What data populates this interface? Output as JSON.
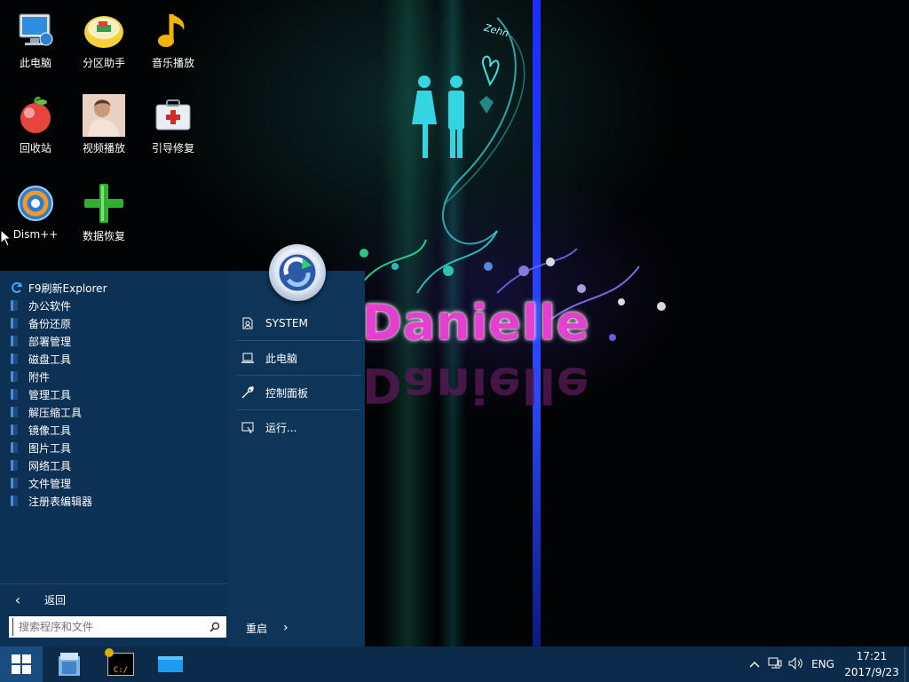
{
  "wallpaper": {
    "brand_text": "Danielle",
    "tag_text": "Zehn"
  },
  "desktop_icons": [
    {
      "label": "此电脑",
      "icon": "computer-icon"
    },
    {
      "label": "分区助手",
      "icon": "partition-assistant-icon"
    },
    {
      "label": "音乐播放",
      "icon": "music-note-icon"
    },
    {
      "label": "回收站",
      "icon": "recycle-bin-icon"
    },
    {
      "label": "视频播放",
      "icon": "video-player-icon"
    },
    {
      "label": "引导修复",
      "icon": "first-aid-kit-icon"
    },
    {
      "label": "Dism++",
      "icon": "dism-icon"
    },
    {
      "label": "数据恢复",
      "icon": "green-plus-icon"
    }
  ],
  "start_menu": {
    "refresh_label": "F9刷新Explorer",
    "app_folders": [
      "办公软件",
      "备份还原",
      "部署管理",
      "磁盘工具",
      "附件",
      "管理工具",
      "解压缩工具",
      "镜像工具",
      "图片工具",
      "网络工具",
      "文件管理",
      "注册表编辑器"
    ],
    "back_label": "返回",
    "search_placeholder": "搜索程序和文件",
    "places": [
      {
        "label": "SYSTEM",
        "icon": "user-folder-icon"
      },
      {
        "label": "此电脑",
        "icon": "laptop-icon"
      },
      {
        "label": "控制面板",
        "icon": "wrench-icon"
      },
      {
        "label": "运行...",
        "icon": "run-icon"
      }
    ],
    "restart_label": "重启"
  },
  "taskbar": {
    "apps": [
      "explorer-icon",
      "cmd-icon",
      "desktop-window-icon"
    ],
    "cmd_text": "C:/",
    "language": "ENG",
    "time": "17:21",
    "date": "2017/9/23"
  },
  "colors": {
    "start_menu_bg": "#0c3155",
    "taskbar_bg": "#0c2a4a",
    "brand_pink": "#e43fcf"
  }
}
